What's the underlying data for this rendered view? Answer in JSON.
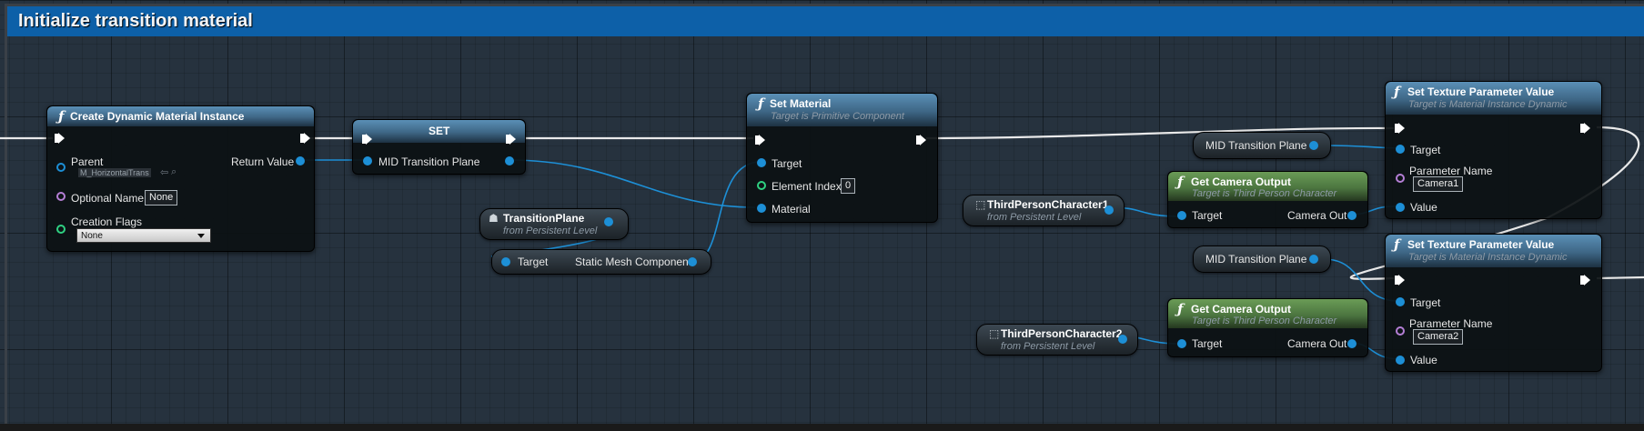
{
  "comment": {
    "title": "Initialize transition material",
    "color": "#0d60a8"
  },
  "colors": {
    "object_pin": "#1d8fd6",
    "name_pin": "#b57fd6",
    "int_pin": "#2fd182",
    "exec": "#ffffff",
    "function_header": "#3e6685",
    "pure_function_header": "#4c7640"
  },
  "nodes": {
    "create_dmi": {
      "title": "Create Dynamic Material Instance",
      "icon": "function-icon",
      "pins": {
        "parent": "Parent",
        "return_value": "Return Value",
        "optional_name": "Optional Name",
        "creation_flags": "Creation Flags"
      },
      "values": {
        "parent_asset": "M_HorizontalTrans",
        "optional_name": "None",
        "creation_flags": "None"
      }
    },
    "set_var": {
      "title": "SET",
      "pin_label": "MID Transition Plane"
    },
    "set_material": {
      "title": "Set Material",
      "subtitle": "Target is Primitive Component",
      "pins": {
        "target": "Target",
        "element_index": "Element Index",
        "material": "Material"
      },
      "values": {
        "element_index": "0"
      }
    },
    "transition_plane": {
      "title": "TransitionPlane",
      "subtitle": "from Persistent Level"
    },
    "get_static_mesh": {
      "target": "Target",
      "output": "Static Mesh Component"
    },
    "third_person_1": {
      "title": "ThirdPersonCharacter1",
      "subtitle": "from Persistent Level"
    },
    "third_person_2": {
      "title": "ThirdPersonCharacter2",
      "subtitle": "from Persistent Level"
    },
    "get_camera_output_1": {
      "title": "Get Camera Output",
      "subtitle": "Target is Third Person Character",
      "target": "Target",
      "output": "Camera Out"
    },
    "get_camera_output_2": {
      "title": "Get Camera Output",
      "subtitle": "Target is Third Person Character",
      "target": "Target",
      "output": "Camera Out"
    },
    "mid_getter_1": {
      "label": "MID Transition Plane"
    },
    "mid_getter_2": {
      "label": "MID Transition Plane"
    },
    "set_texture_1": {
      "title": "Set Texture Parameter Value",
      "subtitle": "Target is Material Instance Dynamic",
      "pins": {
        "target": "Target",
        "parameter_name": "Parameter Name",
        "value": "Value"
      },
      "values": {
        "parameter_name": "Camera1"
      }
    },
    "set_texture_2": {
      "title": "Set Texture Parameter Value",
      "subtitle": "Target is Material Instance Dynamic",
      "pins": {
        "target": "Target",
        "parameter_name": "Parameter Name",
        "value": "Value"
      },
      "values": {
        "parameter_name": "Camera2"
      }
    }
  }
}
